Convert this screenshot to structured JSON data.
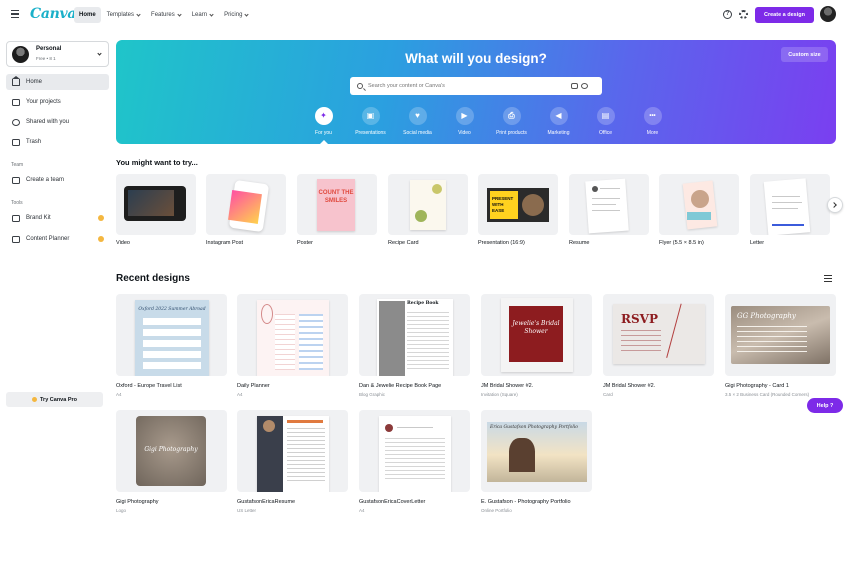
{
  "topbar": {
    "logo": "Canva",
    "nav": [
      {
        "label": "Home",
        "active": true,
        "dropdown": false
      },
      {
        "label": "Templates",
        "active": false,
        "dropdown": true
      },
      {
        "label": "Features",
        "active": false,
        "dropdown": true
      },
      {
        "label": "Learn",
        "active": false,
        "dropdown": true
      },
      {
        "label": "Pricing",
        "active": false,
        "dropdown": true
      }
    ],
    "help_icon": "?",
    "settings_icon": "gear-icon",
    "create_button": "Create a design"
  },
  "sidebar": {
    "account": {
      "name": "Personal",
      "plan": "Free • 8 1"
    },
    "items": [
      {
        "label": "Home",
        "icon": "home-icon",
        "active": true
      },
      {
        "label": "Your projects",
        "icon": "folder-icon",
        "active": false
      },
      {
        "label": "Shared with you",
        "icon": "shared-icon",
        "active": false
      },
      {
        "label": "Trash",
        "icon": "trash-icon",
        "active": false
      }
    ],
    "team_label": "Team",
    "team_items": [
      {
        "label": "Create a team",
        "icon": "team-icon"
      }
    ],
    "tools_label": "Tools",
    "tools_items": [
      {
        "label": "Brand Kit",
        "icon": "brand-kit-icon",
        "pro": true
      },
      {
        "label": "Content Planner",
        "icon": "calendar-icon",
        "pro": true
      }
    ],
    "try_pro": "Try Canva Pro"
  },
  "hero": {
    "title": "What will you design?",
    "custom_size": "Custom size",
    "search_placeholder": "Search your content or Canva's",
    "categories": [
      {
        "label": "For you",
        "glyph": "✦",
        "active": true
      },
      {
        "label": "Presentations",
        "glyph": "▣",
        "active": false
      },
      {
        "label": "Social media",
        "glyph": "♥",
        "active": false
      },
      {
        "label": "Video",
        "glyph": "▶",
        "active": false
      },
      {
        "label": "Print products",
        "glyph": "⎙",
        "active": false
      },
      {
        "label": "Marketing",
        "glyph": "◀",
        "active": false
      },
      {
        "label": "Office",
        "glyph": "▤",
        "active": false
      },
      {
        "label": "More",
        "glyph": "•••",
        "active": false
      }
    ]
  },
  "suggestions": {
    "title": "You might want to try...",
    "items": [
      {
        "label": "Video"
      },
      {
        "label": "Instagram Post"
      },
      {
        "label": "Poster"
      },
      {
        "label": "Recipe Card"
      },
      {
        "label": "Presentation (16:9)"
      },
      {
        "label": "Resume"
      },
      {
        "label": "Flyer (5.5 × 8.5 in)"
      },
      {
        "label": "Letter"
      }
    ],
    "thumb_text": {
      "poster": "COUNT THE SMILES",
      "presentation": "PRESENT WITH EASE"
    }
  },
  "recent": {
    "title": "Recent designs",
    "items": [
      {
        "name": "Oxford - Europe Travel List",
        "type": "A4",
        "thumb_text": "Oxford 2022 Summer Abroad"
      },
      {
        "name": "Daily Planner",
        "type": "A4",
        "thumb_text": ""
      },
      {
        "name": "Dan & Jewelie Recipe Book Page",
        "type": "Blog Graphic",
        "thumb_text": "Recipe Book"
      },
      {
        "name": "JM Bridal Shower #2.",
        "type": "Invitation (Square)",
        "thumb_text": "Jewelie's Bridal Shower"
      },
      {
        "name": "JM Bridal Shower #2.",
        "type": "Card",
        "thumb_text": "RSVP"
      },
      {
        "name": "Gigi Photography - Card 1",
        "type": "3.5 × 2 Business Card (Rounded Corners)",
        "thumb_text": "GG Photography"
      },
      {
        "name": "Gigi Photography",
        "type": "Logo",
        "thumb_text": "Gigi Photography"
      },
      {
        "name": "GustafsonEricaResume",
        "type": "US Letter",
        "thumb_text": ""
      },
      {
        "name": "GustafsonEricaCoverLetter",
        "type": "A4",
        "thumb_text": ""
      },
      {
        "name": "E. Gustafson - Photography Portfolio",
        "type": "Online Portfolio",
        "thumb_text": "Erica Gustafson Photography Portfolio"
      }
    ]
  },
  "help_button": "Help ?",
  "colors": {
    "brand_purple": "#7d2ae8",
    "canva_teal": "#1ab0c9",
    "pro_gold": "#f4b740"
  }
}
